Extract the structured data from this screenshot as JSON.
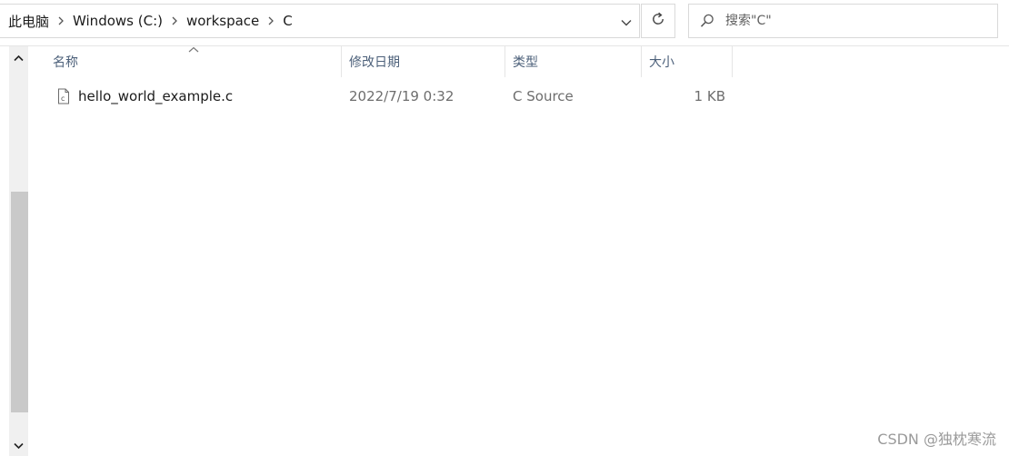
{
  "address_bar": {
    "breadcrumbs": [
      "此电脑",
      "Windows (C:)",
      "workspace",
      "C"
    ]
  },
  "search": {
    "placeholder": "搜索\"C\""
  },
  "columns": {
    "name": "名称",
    "date_modified": "修改日期",
    "type": "类型",
    "size": "大小"
  },
  "files": [
    {
      "name": "hello_world_example.c",
      "date_modified": "2022/7/19 0:32",
      "type": "C Source",
      "size": "1 KB",
      "icon": "c-source-file-icon"
    }
  ],
  "watermark": "CSDN @独枕寒流"
}
